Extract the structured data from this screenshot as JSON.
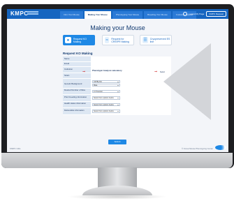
{
  "header": {
    "logo": "KMPC",
    "tabs": [
      {
        "label": "Intro Your Mouse",
        "active": false
      },
      {
        "label": "Making Your Mouse",
        "active": true
      },
      {
        "label": "Phenotyping Your Mouse",
        "active": false
      },
      {
        "label": "Breeding Your Mouse",
        "active": false
      },
      {
        "label": "Customer Support",
        "active": false
      }
    ],
    "user_link": "Logout  My Page",
    "user_button": "KMPC Request"
  },
  "page": {
    "title": "Making your Mouse",
    "options": [
      {
        "label": "Request KO Making",
        "icon": "mouse-icon",
        "selected": true
      },
      {
        "label": "Request for CRISPR Making",
        "icon": "dna-icon",
        "selected": false
      },
      {
        "label": "Cryopreserved ES line",
        "icon": "document-icon",
        "selected": false
      }
    ],
    "section_title": "Request KO Making"
  },
  "form": {
    "rows": [
      {
        "label": "Name",
        "value": ""
      },
      {
        "label": "Email",
        "value": ""
      },
      {
        "label": "Institution",
        "value": "Phenotypic Analysis Laboratory"
      },
      {
        "label": "Strain",
        "value": ""
      },
      {
        "label": "Genetic Background",
        "value": "C57BL/6N"
      },
      {
        "label": "",
        "value": "Male"
      },
      {
        "label": "Desired Number of Mice",
        "value": "2-3 founder"
      },
      {
        "label": "Prior breeding information",
        "value": "Select from options below"
      },
      {
        "label": "Health status information",
        "value": "Select from options below"
      },
      {
        "label": "Deliverable information",
        "value": "Select from options below"
      }
    ],
    "side_note": "Select",
    "submit_label": "Submit"
  },
  "footer": {
    "left": "KMPC Utils",
    "right": "© Korea Mouse Phenotyping Center"
  },
  "colors": {
    "brand": "#1565c0",
    "accent": "#1e88e5",
    "arrow": "#d32f2f"
  }
}
